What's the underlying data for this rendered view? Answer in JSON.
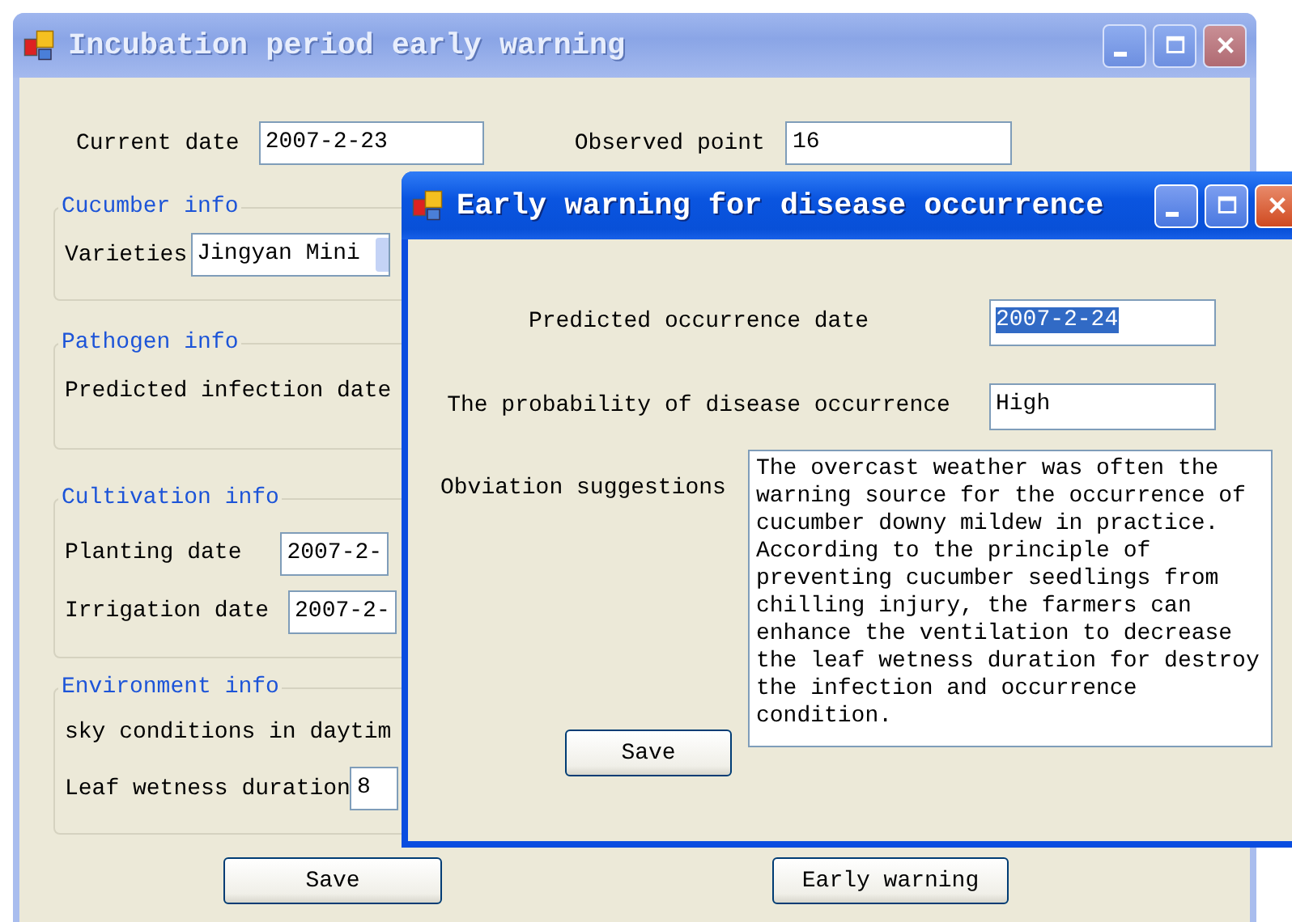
{
  "main_window": {
    "title": "Incubation period early warning",
    "active": false,
    "fields": [
      {
        "label": "Current date",
        "value": "2007-2-23"
      },
      {
        "label": "Observed point",
        "value": "16"
      }
    ],
    "groups": [
      {
        "title": "Cucumber info",
        "rows": [
          {
            "kind": "combo",
            "label": "Varieties",
            "value": "Jingyan Mini"
          }
        ]
      },
      {
        "title": "Pathogen info",
        "rows": [
          {
            "kind": "label",
            "label": "Predicted infection date"
          }
        ]
      },
      {
        "title": "Cultivation info",
        "rows": [
          {
            "kind": "text",
            "label": "Planting date",
            "value": "2007-2-"
          },
          {
            "kind": "text",
            "label": "Irrigation date",
            "value": "2007-2-"
          }
        ]
      },
      {
        "title": "Environment info",
        "rows": [
          {
            "kind": "label",
            "label": "sky conditions in daytim"
          },
          {
            "kind": "text",
            "label": "Leaf wetness duration",
            "value": "8"
          }
        ]
      }
    ],
    "buttons": [
      "Save",
      "Early warning"
    ]
  },
  "dialog": {
    "title": "Early warning for disease occurrence",
    "active": true,
    "fields": [
      {
        "label": "Predicted occurrence date",
        "value": "2007-2-24",
        "selected": true
      },
      {
        "label": "The probability of disease occurrence",
        "value": "High",
        "selected": false
      }
    ],
    "suggestions": {
      "label": "Obviation suggestions",
      "value": "The overcast weather was often the warning source for the occurrence of cucumber downy mildew in practice. According to the principle of preventing cucumber seedlings from chilling injury, the farmers can enhance the ventilation to decrease the leaf wetness duration for destroy the infection and occurrence condition."
    },
    "button": "Save"
  }
}
